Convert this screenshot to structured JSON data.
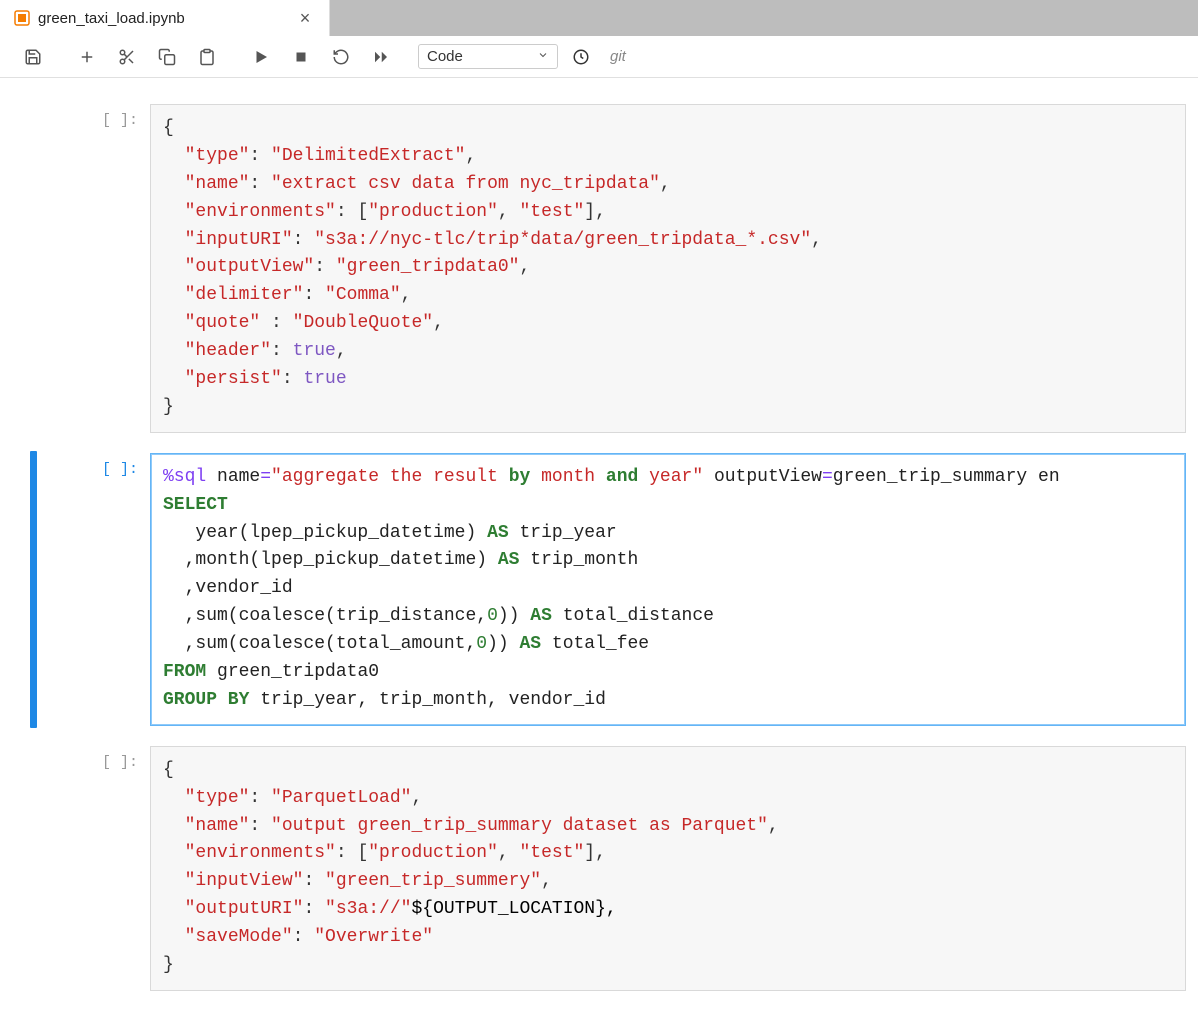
{
  "tab": {
    "title": "green_taxi_load.ipynb"
  },
  "toolbar": {
    "celltype": "Code",
    "git": "git"
  },
  "prompts": {
    "empty": "[ ]:"
  },
  "cells": {
    "c1": {
      "open": "{",
      "l1_k": "\"type\"",
      "l1_c": ": ",
      "l1_v": "\"DelimitedExtract\"",
      "l1_e": ",",
      "l2_k": "\"name\"",
      "l2_c": ": ",
      "l2_v": "\"extract csv data from nyc_tripdata\"",
      "l2_e": ",",
      "l3_k": "\"environments\"",
      "l3_c": ": [",
      "l3_v1": "\"production\"",
      "l3_m": ", ",
      "l3_v2": "\"test\"",
      "l3_e": "],",
      "l4_k": "\"inputURI\"",
      "l4_c": ": ",
      "l4_v": "\"s3a://nyc-tlc/trip*data/green_tripdata_*.csv\"",
      "l4_e": ",",
      "l5_k": "\"outputView\"",
      "l5_c": ": ",
      "l5_v": "\"green_tripdata0\"",
      "l5_e": ",",
      "l6_k": "\"delimiter\"",
      "l6_c": ": ",
      "l6_v": "\"Comma\"",
      "l6_e": ",",
      "l7_k": "\"quote\"",
      "l7_c": " : ",
      "l7_v": "\"DoubleQuote\"",
      "l7_e": ",",
      "l8_k": "\"header\"",
      "l8_c": ": ",
      "l8_v": "true",
      "l8_e": ",",
      "l9_k": "\"persist\"",
      "l9_c": ": ",
      "l9_v": "true",
      "close": "}"
    },
    "c2": {
      "magic": "%sql",
      "attr_name_k": " name",
      "attr_name_eq": "=",
      "attr_name_v": "\"aggregate the result ",
      "by": "by",
      "mid1": " month ",
      "and": "and",
      "mid2": " year\"",
      "attr_ov_k": " outputView",
      "attr_ov_eq": "=",
      "attr_ov_v": "green_trip_summary en",
      "select": "SELECT",
      "l1a": "   year(lpep_pickup_datetime) ",
      "AS1": "AS",
      "l1b": " trip_year",
      "l2a": "  ,month(lpep_pickup_datetime) ",
      "AS2": "AS",
      "l2b": " trip_month",
      "l3": "  ,vendor_id",
      "l4a": "  ,sum(coalesce(trip_distance,",
      "zero1": "0",
      "l4b": ")) ",
      "AS3": "AS",
      "l4c": " total_distance",
      "l5a": "  ,sum(coalesce(total_amount,",
      "zero2": "0",
      "l5b": ")) ",
      "AS4": "AS",
      "l5c": " total_fee",
      "from": "FROM",
      "from_t": " green_tripdata0",
      "group": "GROUP BY",
      "group_t": " trip_year, trip_month, vendor_id"
    },
    "c3": {
      "open": "{",
      "l1_k": "\"type\"",
      "l1_c": ": ",
      "l1_v": "\"ParquetLoad\"",
      "l1_e": ",",
      "l2_k": "\"name\"",
      "l2_c": ": ",
      "l2_v": "\"output green_trip_summary dataset as Parquet\"",
      "l2_e": ",",
      "l3_k": "\"environments\"",
      "l3_c": ": [",
      "l3_v1": "\"production\"",
      "l3_m": ", ",
      "l3_v2": "\"test\"",
      "l3_e": "],",
      "l4_k": "\"inputView\"",
      "l4_c": ": ",
      "l4_v": "\"green_trip_summery\"",
      "l4_e": ",",
      "l5_k": "\"outputURI\"",
      "l5_c": ": ",
      "l5_v": "\"s3a://\"",
      "l5_x": "${OUTPUT_LOCATION},",
      "l6_k": "\"saveMode\"",
      "l6_c": ": ",
      "l6_v": "\"Overwrite\"",
      "close": "}"
    }
  }
}
